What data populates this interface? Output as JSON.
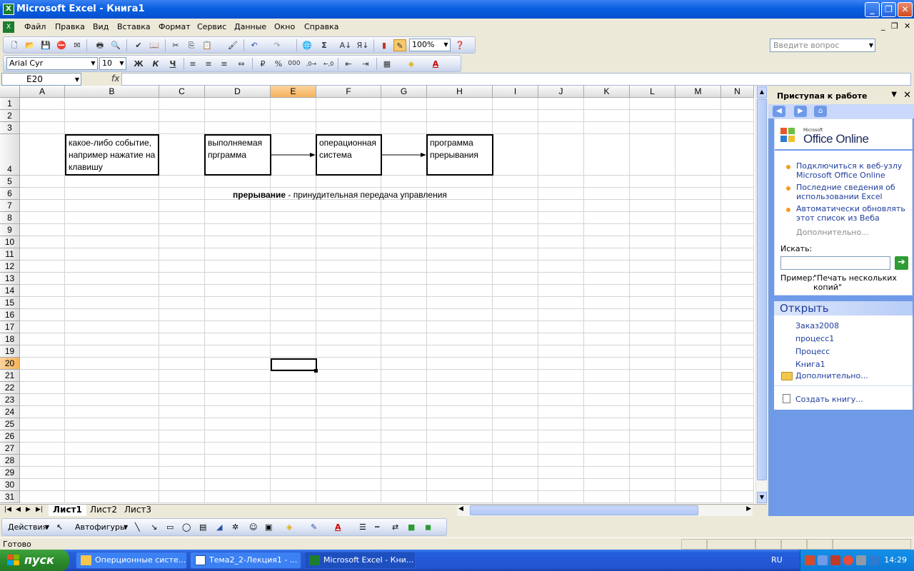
{
  "window": {
    "title": "Microsoft Excel - Книга1",
    "app_icon": "excel-icon"
  },
  "menu": {
    "items": [
      "Файл",
      "Правка",
      "Вид",
      "Вставка",
      "Формат",
      "Сервис",
      "Данные",
      "Окно",
      "Справка"
    ],
    "ask_placeholder": "Введите вопрос"
  },
  "standard_toolbar": {
    "zoom": "100%"
  },
  "format_toolbar": {
    "font": "Arial Cyr",
    "size": "10",
    "bold": "Ж",
    "italic": "К",
    "underline": "Ч"
  },
  "formula_bar": {
    "cell_ref": "E20",
    "fx": "fx",
    "value": ""
  },
  "sheet": {
    "columns": [
      "A",
      "B",
      "C",
      "D",
      "E",
      "F",
      "G",
      "H",
      "I",
      "J",
      "K",
      "L",
      "M",
      "N"
    ],
    "rows": [
      "1",
      "2",
      "3",
      "4",
      "5",
      "6",
      "7",
      "8",
      "9",
      "10",
      "11",
      "12",
      "13",
      "14",
      "15",
      "16",
      "17",
      "18",
      "19",
      "20",
      "21",
      "22",
      "23",
      "24",
      "25",
      "26",
      "27",
      "28",
      "29",
      "30",
      "31"
    ],
    "selected_cell": "E20",
    "boxes": {
      "event": "какое-либо событие, например нажатие на клавишу",
      "program": "выполняемая прграмма",
      "os": "операционная система",
      "interrupt_program": "программа прерывания"
    },
    "caption_bold": "прерывание",
    "caption_rest": " - принудительная передача управления"
  },
  "sheet_tabs": [
    "Лист1",
    "Лист2",
    "Лист3"
  ],
  "task_pane": {
    "title": "Приступая к работе",
    "logo_small": "Microsoft",
    "logo_big": "Office Online",
    "links": [
      "Подключиться к веб-узлу Microsoft Office Online",
      "Последние сведения об использовании Excel",
      "Автоматически обновлять этот список из Веба"
    ],
    "more": "Дополнительно...",
    "search_label": "Искать:",
    "example_label": "Пример:",
    "example_text": "\"Печать нескольких копий\"",
    "open_header": "Открыть",
    "recent_files": [
      "Заказ2008",
      "процесс1",
      "Процесс",
      "Книга1"
    ],
    "open_more": "Дополнительно...",
    "create": "Создать книгу..."
  },
  "drawing_toolbar": {
    "actions": "Действия",
    "autoshapes": "Автофигуры"
  },
  "status": {
    "text": "Готово"
  },
  "taskbar": {
    "start": "пуск",
    "tasks": [
      "Оперционные систе...",
      "Тема2_2-Лекция1 - ...",
      "Microsoft Excel - Кни..."
    ],
    "lang": "RU",
    "time": "14:29"
  }
}
